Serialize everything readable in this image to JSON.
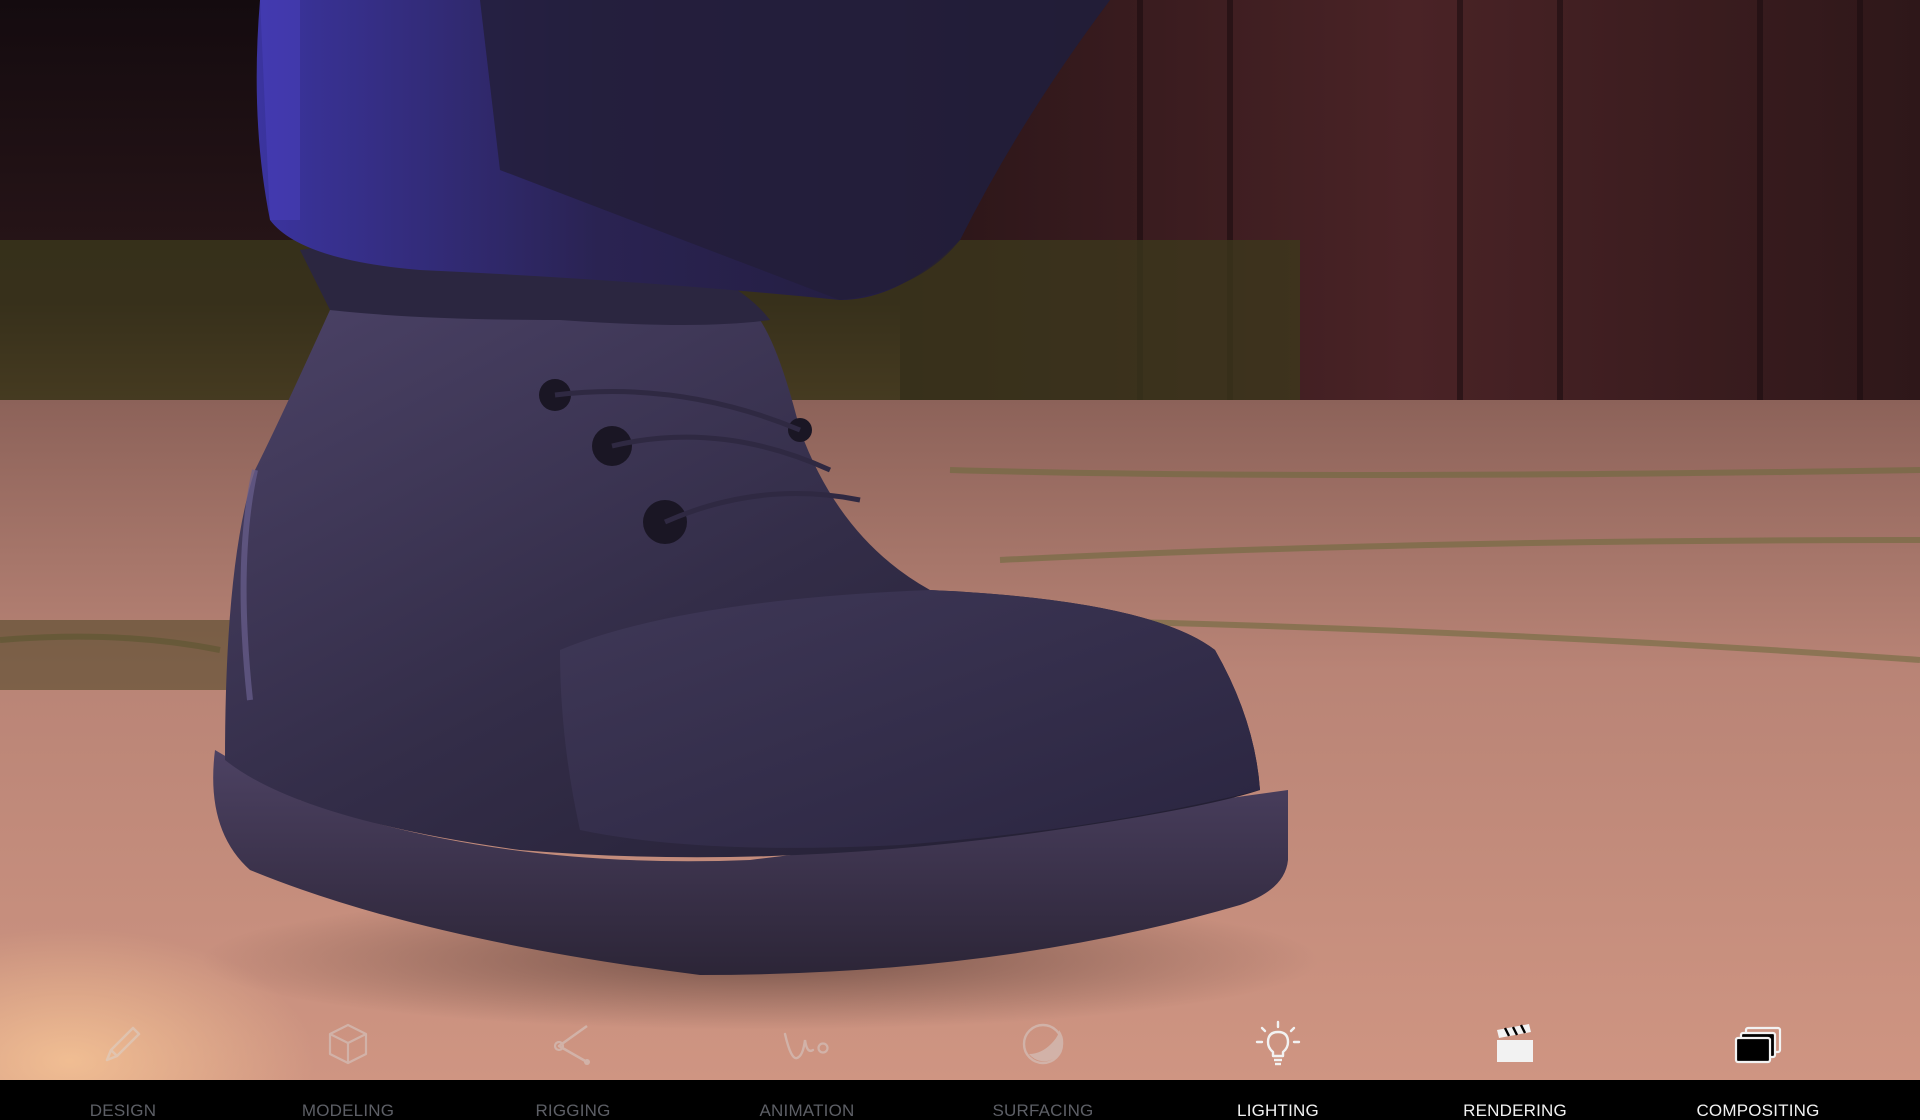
{
  "scene": {
    "subject": "boot",
    "colors": {
      "sky_dark": "#1a0f12",
      "fence": "#3a1c1f",
      "grass": "#4e4a22",
      "pavement": "#c58b7c",
      "pavement_glow": "#d59a84",
      "boot": "#3a3450",
      "boot_highlight": "#6a5f86",
      "pant": "#2a2548",
      "pant_light": "#4a3fa0"
    }
  },
  "pipeline": {
    "active_color": "#f1f1f1",
    "inactive_color": "#5d5f66",
    "stages": [
      {
        "label": "DESIGN",
        "icon": "pencil-icon",
        "active": false
      },
      {
        "label": "MODELING",
        "icon": "cube-icon",
        "active": false
      },
      {
        "label": "RIGGING",
        "icon": "rig-joint-icon",
        "active": false
      },
      {
        "label": "ANIMATION",
        "icon": "motion-path-icon",
        "active": false
      },
      {
        "label": "SURFACING",
        "icon": "shaded-sphere-icon",
        "active": false
      },
      {
        "label": "LIGHTING",
        "icon": "lightbulb-icon",
        "active": true
      },
      {
        "label": "RENDERING",
        "icon": "clapperboard-icon",
        "active": true
      },
      {
        "label": "COMPOSITING",
        "icon": "stacked-layers-icon",
        "active": true
      }
    ]
  }
}
